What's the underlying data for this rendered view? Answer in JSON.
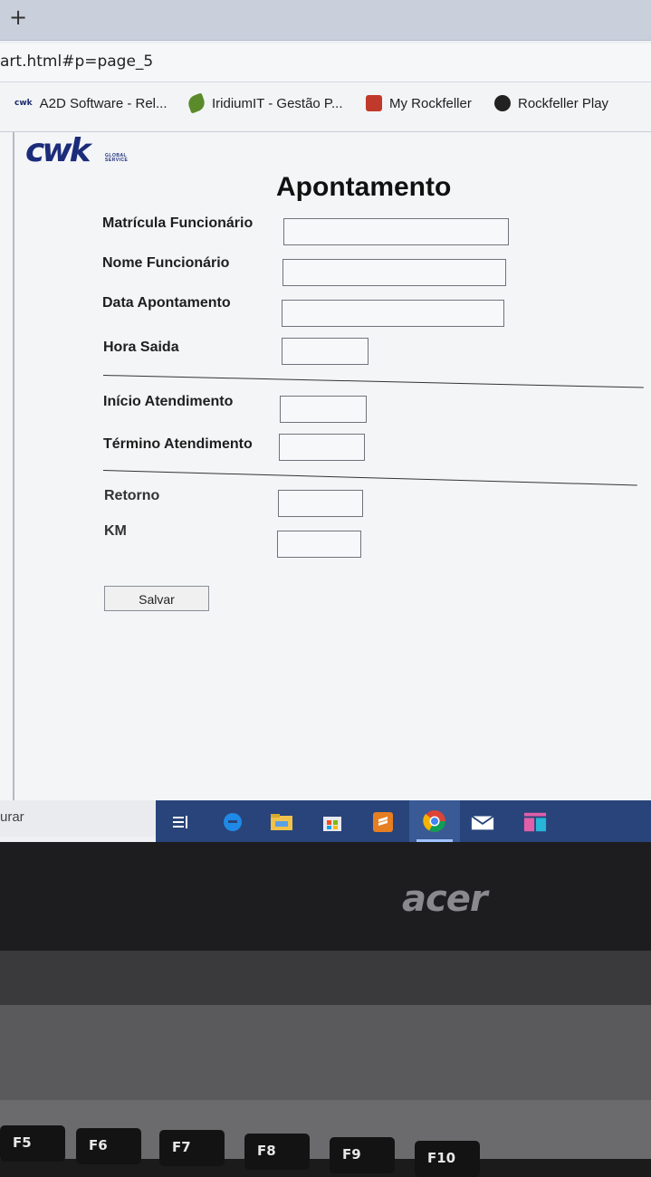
{
  "browser": {
    "new_tab_symbol": "+",
    "address": "art.html#p=page_5",
    "bookmarks": [
      {
        "label": "A2D Software - Rel...",
        "icon": "cmk-icon"
      },
      {
        "label": "IridiumIT - Gestão P...",
        "icon": "leaf-icon"
      },
      {
        "label": "My Rockfeller",
        "icon": "rockfeller-icon"
      },
      {
        "label": "Rockfeller Play",
        "icon": "globe-icon"
      }
    ],
    "bookmark_icon_text": "cwk"
  },
  "logo": {
    "text": "cwk",
    "sub_line1": "GLOBAL",
    "sub_line2": "SERVICE"
  },
  "form": {
    "title": "Apontamento",
    "fields": {
      "matricula": {
        "label": "Matrícula Funcionário",
        "value": ""
      },
      "nome": {
        "label": "Nome Funcionário",
        "value": ""
      },
      "data": {
        "label": "Data Apontamento",
        "value": ""
      },
      "hora_saida": {
        "label": "Hora Saida",
        "value": ""
      },
      "inicio": {
        "label": "Início Atendimento",
        "value": ""
      },
      "termino": {
        "label": "Término Atendimento",
        "value": ""
      },
      "retorno": {
        "label": "Retorno",
        "value": ""
      },
      "km": {
        "label": "KM",
        "value": ""
      }
    },
    "save_label": "Salvar"
  },
  "statusbar": {
    "text": "urar"
  },
  "taskbar": {
    "icons": [
      "task-view-icon",
      "edge-icon",
      "file-explorer-icon",
      "store-icon",
      "sublime-icon",
      "chrome-icon",
      "mail-icon",
      "app-icon"
    ]
  },
  "laptop": {
    "brand": "acer",
    "keys": [
      "F5",
      "F6",
      "F7",
      "F8",
      "F9",
      "F10"
    ]
  }
}
